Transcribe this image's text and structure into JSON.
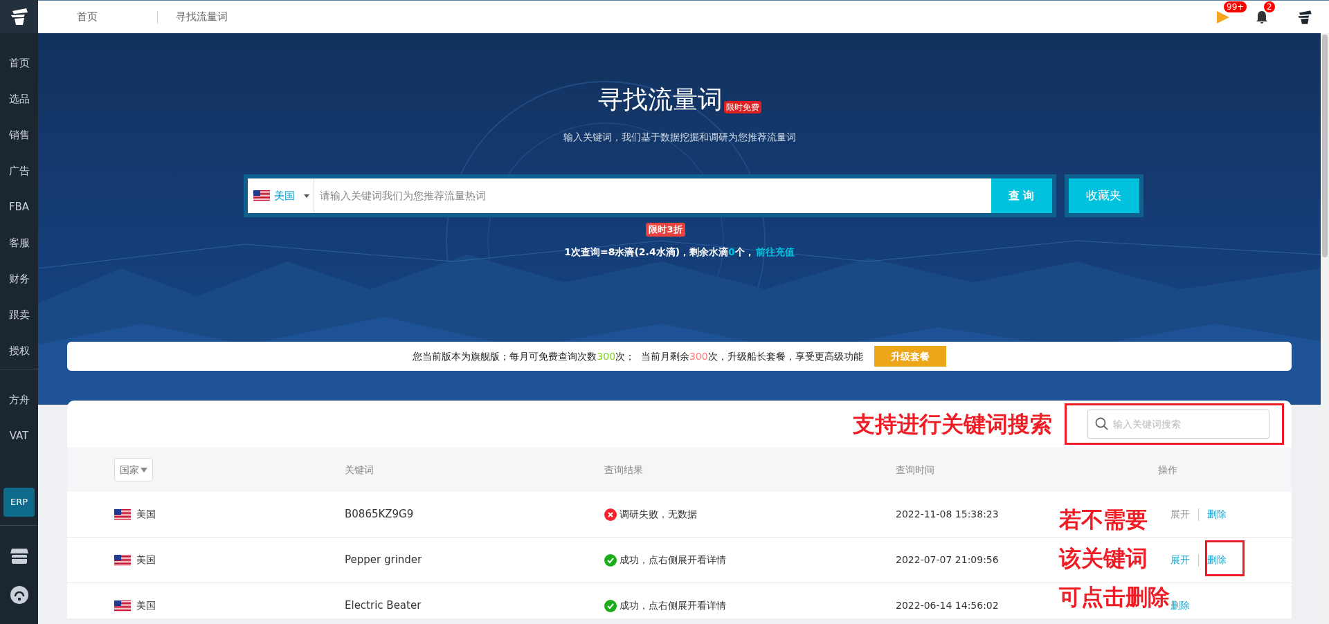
{
  "sidebar": {
    "items": [
      {
        "label": "首页"
      },
      {
        "label": "选品"
      },
      {
        "label": "销售"
      },
      {
        "label": "广告"
      },
      {
        "label": "FBA"
      },
      {
        "label": "客服"
      },
      {
        "label": "财务"
      },
      {
        "label": "跟卖"
      },
      {
        "label": "授权"
      }
    ],
    "extra_items": [
      {
        "label": "方舟"
      },
      {
        "label": "VAT"
      }
    ],
    "erp": "ERP"
  },
  "topbar": {
    "breadcrumb": [
      "首页",
      "寻找流量词"
    ],
    "flag_badge": "99+",
    "bell_badge": "2"
  },
  "hero": {
    "title": "寻找流量词",
    "title_badge": "限时免费",
    "subtitle": "输入关键词，我们基于数据挖掘和调研为您推荐流量词",
    "country": "美国",
    "search_placeholder": "请输入关键词我们为您推荐流量热词",
    "query_button": "查 询",
    "favorites_button": "收藏夹",
    "discount_badge": "限时3折",
    "cost_parts": [
      {
        "text": "1次查询=",
        "kind": "plain"
      },
      {
        "text": "8水滴",
        "kind": "struck"
      },
      {
        "text": "(2.4水滴)，剩余水滴",
        "kind": "plain"
      },
      {
        "text": "0",
        "kind": "accent"
      },
      {
        "text": "个，",
        "kind": "plain"
      }
    ],
    "recharge_link": "前往充值"
  },
  "notice": {
    "parts": [
      {
        "text": "您当前版本为旗舰版；每月可免费查询次数",
        "kind": "plain"
      },
      {
        "text": "300",
        "kind": "good"
      },
      {
        "text": "次；  当前月剩余",
        "kind": "plain"
      },
      {
        "text": "300",
        "kind": "warn"
      },
      {
        "text": "次，升级船长套餐，享受更高级功能",
        "kind": "plain"
      }
    ],
    "upgrade_button": "升级套餐"
  },
  "table": {
    "search_placeholder": "输入关键词搜索",
    "country_filter": "国家",
    "columns": [
      "关键词",
      "查询结果",
      "查询时间",
      "操作"
    ],
    "rows": [
      {
        "country": "美国",
        "keyword": "B0865KZ9G9",
        "kind": "failed",
        "result": "调研失败，无数据",
        "time": "2022-11-08 15:38:23",
        "actions": [
          {
            "label": "展开",
            "disabled": true
          },
          {
            "label": "删除",
            "disabled": false
          }
        ]
      },
      {
        "country": "美国",
        "keyword": "Pepper grinder",
        "kind": "success",
        "result": "成功，点右侧展开看详情",
        "time": "2022-07-07 21:09:56",
        "actions": [
          {
            "label": "展开",
            "disabled": false
          },
          {
            "label": "删除",
            "disabled": false
          }
        ]
      },
      {
        "country": "美国",
        "keyword": "Electric Beater",
        "kind": "success",
        "result": "成功，点右侧展开看详情",
        "time": "2022-06-14 14:56:02",
        "actions": [
          {
            "label": "删除",
            "disabled": false
          }
        ]
      }
    ]
  },
  "annotations": {
    "search_note": "支持进行关键词搜索",
    "delete_note": [
      "若不需要",
      "该关键词",
      "可点击删除"
    ]
  }
}
